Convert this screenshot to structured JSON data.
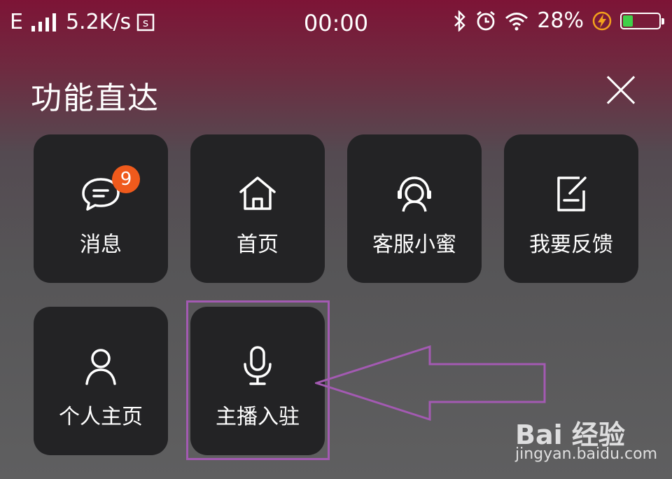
{
  "status_bar": {
    "network": "E",
    "speed": "5.2K/s",
    "time": "00:00",
    "battery_percent": "28%",
    "battery_level": 0.28,
    "accent_battery": "#3fd04a",
    "bolt_color": "#f4a21c"
  },
  "panel": {
    "title": "功能直达",
    "close_icon": "close-icon"
  },
  "tiles": [
    {
      "label": "消息",
      "icon": "chat-bubble-icon",
      "badge": "9"
    },
    {
      "label": "首页",
      "icon": "home-icon"
    },
    {
      "label": "客服小蜜",
      "icon": "headset-agent-icon"
    },
    {
      "label": "我要反馈",
      "icon": "edit-note-icon"
    },
    {
      "label": "个人主页",
      "icon": "person-icon"
    },
    {
      "label": "主播入驻",
      "icon": "microphone-icon"
    }
  ],
  "annotation": {
    "highlight_color": "#a35ab2"
  },
  "watermark": {
    "brand": "Bai 经验",
    "url": "jingyan.baidu.com"
  }
}
